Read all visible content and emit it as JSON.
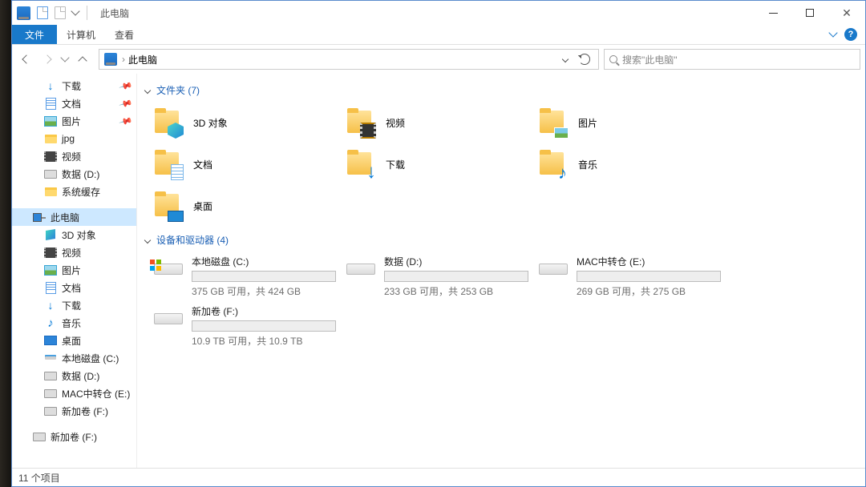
{
  "title": "此电脑",
  "ribbon": {
    "file": "文件",
    "computer": "计算机",
    "view": "查看"
  },
  "addr": "此电脑",
  "search_placeholder": "搜索\"此电脑\"",
  "tree": {
    "quick": [
      {
        "label": "下载",
        "icon": "dl",
        "pin": true
      },
      {
        "label": "文档",
        "icon": "doc",
        "pin": true
      },
      {
        "label": "图片",
        "icon": "pic",
        "pin": true
      },
      {
        "label": "jpg",
        "icon": "folder"
      },
      {
        "label": "视频",
        "icon": "vid"
      },
      {
        "label": "数据 (D:)",
        "icon": "hdd"
      },
      {
        "label": "系统缓存",
        "icon": "folder"
      }
    ],
    "thispc_label": "此电脑",
    "thispc_children": [
      {
        "label": "3D 对象",
        "icon": "3d"
      },
      {
        "label": "视频",
        "icon": "vid"
      },
      {
        "label": "图片",
        "icon": "pic"
      },
      {
        "label": "文档",
        "icon": "doc"
      },
      {
        "label": "下载",
        "icon": "dl"
      },
      {
        "label": "音乐",
        "icon": "music"
      },
      {
        "label": "桌面",
        "icon": "desk"
      },
      {
        "label": "本地磁盘 (C:)",
        "icon": "hdd2"
      },
      {
        "label": "数据 (D:)",
        "icon": "hdd"
      },
      {
        "label": "MAC中转仓 (E:)",
        "icon": "hdd"
      },
      {
        "label": "新加卷 (F:)",
        "icon": "hdd"
      }
    ],
    "extra": [
      {
        "label": "新加卷 (F:)",
        "icon": "hdd"
      }
    ]
  },
  "groups": {
    "folders_hdr": "文件夹 (7)",
    "drives_hdr": "设备和驱动器 (4)"
  },
  "folders": [
    {
      "label": "3D 对象",
      "ov": "3d"
    },
    {
      "label": "视频",
      "ov": "vid"
    },
    {
      "label": "图片",
      "ov": "pic"
    },
    {
      "label": "文档",
      "ov": "doc"
    },
    {
      "label": "下载",
      "ov": "dl"
    },
    {
      "label": "音乐",
      "ov": "music"
    },
    {
      "label": "桌面",
      "ov": "desk"
    }
  ],
  "drives": [
    {
      "name": "本地磁盘 (C:)",
      "sub": "375 GB 可用，共 424 GB",
      "fill": 12,
      "win": true
    },
    {
      "name": "数据 (D:)",
      "sub": "233 GB 可用，共 253 GB",
      "fill": 8
    },
    {
      "name": "MAC中转仓 (E:)",
      "sub": "269 GB 可用，共 275 GB",
      "fill": 2
    },
    {
      "name": "新加卷 (F:)",
      "sub": "10.9 TB 可用，共 10.9 TB",
      "fill": 0
    }
  ],
  "status": "11 个项目"
}
